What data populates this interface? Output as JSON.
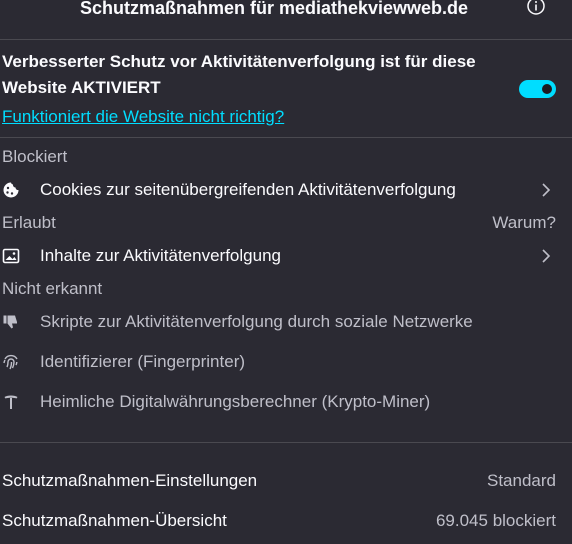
{
  "header": {
    "title": "Schutzmaßnahmen für mediathekviewweb.de",
    "info_icon": "info-icon"
  },
  "status": {
    "text": "Verbesserter Schutz vor Aktivitätenverfolgung ist für diese Website AKTIVIERT",
    "toggle_on": true,
    "accent_color": "#00ddff"
  },
  "help_link": "Funktioniert die Website nicht richtig?",
  "blocked": {
    "heading": "Blockiert",
    "items": [
      {
        "icon": "cookie-icon",
        "label": "Cookies zur seitenübergreifenden Aktivitätenverfolgung"
      }
    ]
  },
  "allowed": {
    "heading": "Erlaubt",
    "why_label": "Warum?",
    "items": [
      {
        "icon": "image-icon",
        "label": "Inhalte zur Aktivitätenverfolgung"
      }
    ]
  },
  "not_detected": {
    "heading": "Nicht erkannt",
    "items": [
      {
        "icon": "thumbs-down-icon",
        "label": "Skripte zur Aktivitätenverfolgung durch soziale Netzwerke"
      },
      {
        "icon": "fingerprint-icon",
        "label": "Identifizierer (Fingerprinter)"
      },
      {
        "icon": "pickaxe-icon",
        "label": "Heimliche Digitalwährungsberechner (Krypto-Miner)"
      }
    ]
  },
  "footer": {
    "settings_label": "Schutzmaßnahmen-Einstellungen",
    "settings_value": "Standard",
    "overview_label": "Schutzmaßnahmen-Übersicht",
    "overview_value": "69.045 blockiert"
  }
}
